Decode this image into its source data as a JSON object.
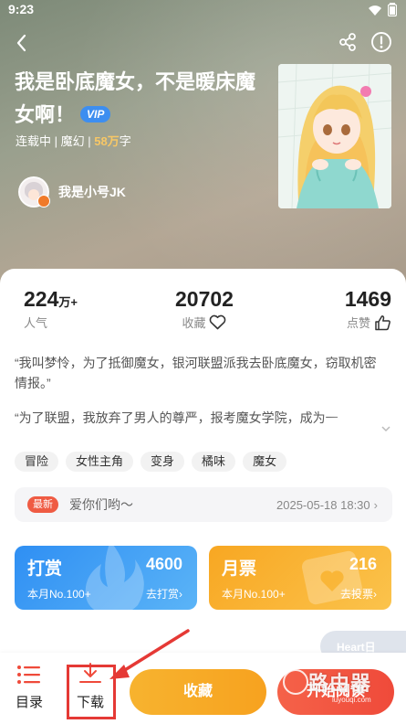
{
  "status": {
    "time": "9:23"
  },
  "book": {
    "title": "我是卧底魔女，不是暖床魔女啊！",
    "vip": "VIP",
    "status": "连载中",
    "genre": "魔幻",
    "words": "58万",
    "words_suffix": "字",
    "separator": " | "
  },
  "author": {
    "name": "我是小号JK"
  },
  "stats": {
    "popularity": {
      "value": "224",
      "unit": "万+",
      "label": "人气"
    },
    "favorites": {
      "value": "20702",
      "label": "收藏"
    },
    "likes": {
      "value": "1469",
      "label": "点赞"
    }
  },
  "synopsis": [
    "“我叫梦怜，为了抵御魔女，银河联盟派我去卧底魔女，窃取机密情报。”",
    "“为了联盟，我放弃了男人的尊严，报考魔女学院，成为一"
  ],
  "tags": [
    "冒险",
    "女性主角",
    "变身",
    "橘味",
    "魔女"
  ],
  "latest": {
    "badge": "最新",
    "text": "爱你们哟～",
    "date": "2025-05-18 18:30",
    "arrow": "›"
  },
  "reward": {
    "title": "打赏",
    "value": "4600",
    "rank": "本月No.100+",
    "action": "去打赏›"
  },
  "ticket": {
    "title": "月票",
    "value": "216",
    "rank": "本月No.100+",
    "action": "去投票›"
  },
  "heart_tab": {
    "label": "Heart日"
  },
  "bottom": {
    "catalog": "目录",
    "download": "下载",
    "favorite": "收藏",
    "read": "开始阅读"
  },
  "watermark": {
    "title": "路由器",
    "url": "luyouqi.com"
  },
  "colors": {
    "accent_orange": "#f7b32f",
    "accent_red": "#ef4a3a",
    "reward_blue": "#2f8ff3",
    "ticket_yellow": "#f8a722",
    "highlight": "#e53935"
  },
  "icons": {
    "back": "chevron-left-icon",
    "share": "share-icon",
    "info": "info-icon",
    "favorite": "heart-outline-icon",
    "like": "thumbs-up-icon",
    "catalog": "list-icon",
    "download": "download-icon"
  }
}
